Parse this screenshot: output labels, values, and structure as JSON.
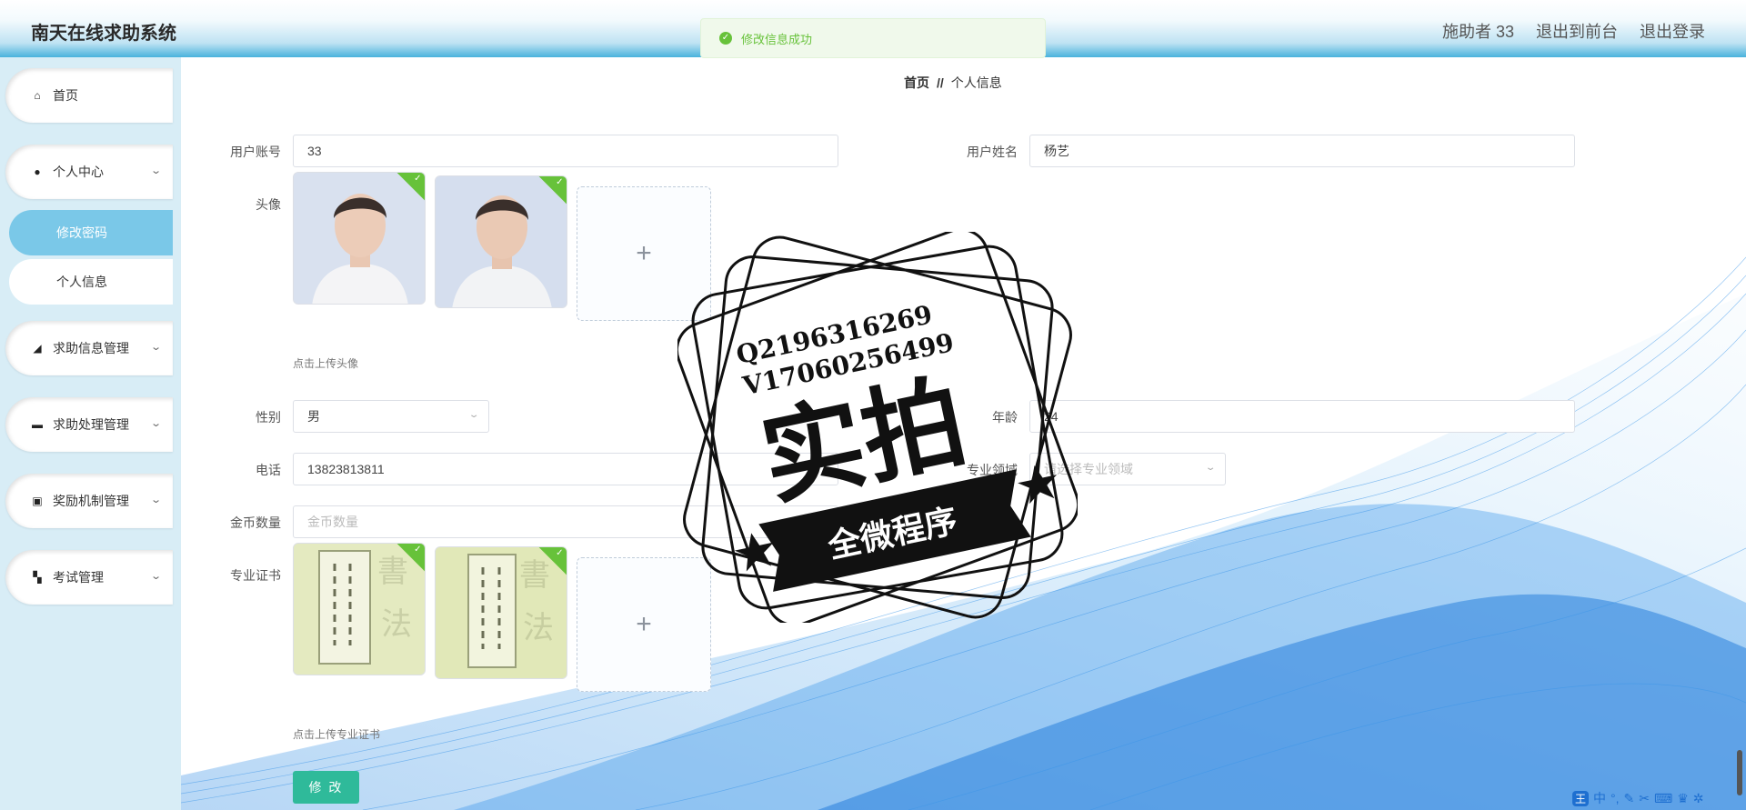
{
  "header": {
    "title": "南天在线求助系统",
    "user": "施助者 33",
    "to_front": "退出到前台",
    "logout": "退出登录"
  },
  "toast": {
    "message": "修改信息成功"
  },
  "sidebar": {
    "items": [
      {
        "label": "首页",
        "icon": "home-icon"
      },
      {
        "label": "个人中心",
        "icon": "user-icon"
      },
      {
        "label": "修改密码"
      },
      {
        "label": "个人信息"
      },
      {
        "label": "求助信息管理",
        "icon": "megaphone-icon"
      },
      {
        "label": "求助处理管理",
        "icon": "chat-icon"
      },
      {
        "label": "奖励机制管理",
        "icon": "briefcase-icon"
      },
      {
        "label": "考试管理",
        "icon": "grid-icon"
      }
    ]
  },
  "breadcrumb": {
    "home": "首页",
    "separator": "//",
    "current": "个人信息"
  },
  "form": {
    "account_label": "用户账号",
    "account_value": "33",
    "name_label": "用户姓名",
    "name_value": "杨艺",
    "avatar_label": "头像",
    "avatar_hint": "点击上传头像",
    "gender_label": "性别",
    "gender_value": "男",
    "age_label": "年龄",
    "age_value": "24",
    "phone_label": "电话",
    "phone_value": "13823813811",
    "field_label": "专业领域",
    "field_placeholder": "请选择专业领域",
    "coins_label": "金币数量",
    "coins_placeholder": "金币数量",
    "cert_label": "专业证书",
    "cert_hint": "点击上传专业证书",
    "submit": "修 改"
  },
  "stamp": {
    "line1": "Q2196316269",
    "line2": "V17060256499",
    "big": "实拍",
    "ribbon": "全微程序"
  },
  "taskbar": {
    "ime": "王",
    "lang": "中"
  }
}
